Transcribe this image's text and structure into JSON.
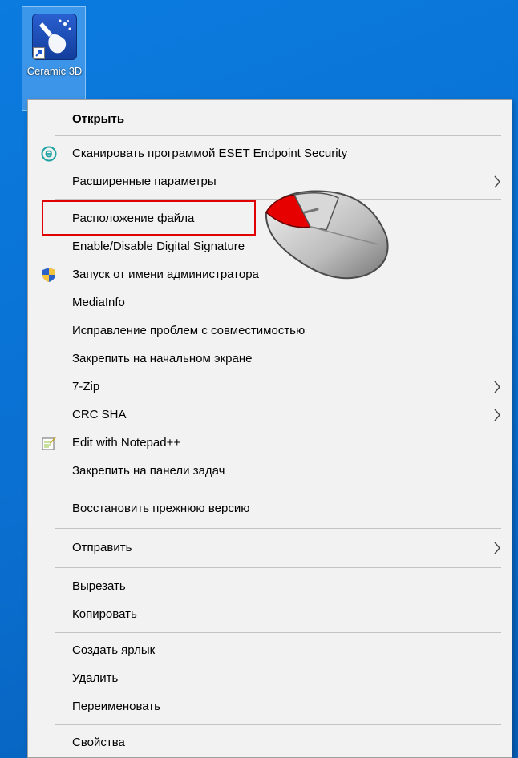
{
  "desktop": {
    "icon_label": "Ceramic 3D",
    "icon_name": "ceramic-3d-icon"
  },
  "menu": {
    "items": [
      {
        "id": "open",
        "label": "Открыть",
        "bold": true
      },
      {
        "id": "eset-scan",
        "label": "Сканировать программой ESET Endpoint Security",
        "icon": "eset-icon"
      },
      {
        "id": "advanced",
        "label": "Расширенные параметры",
        "submenu": true
      },
      {
        "id": "file-location",
        "label": "Расположение файла",
        "highlighted": true
      },
      {
        "id": "digital-signature",
        "label": "Enable/Disable Digital Signature"
      },
      {
        "id": "run-as-admin",
        "label": "Запуск от имени администратора",
        "icon": "uac-shield-icon"
      },
      {
        "id": "mediainfo",
        "label": "MediaInfo"
      },
      {
        "id": "compat",
        "label": "Исправление проблем с совместимостью"
      },
      {
        "id": "pin-start",
        "label": "Закрепить на начальном экране"
      },
      {
        "id": "7zip",
        "label": "7-Zip",
        "submenu": true
      },
      {
        "id": "crc-sha",
        "label": "CRC SHA",
        "submenu": true
      },
      {
        "id": "notepadpp",
        "label": "Edit with Notepad++",
        "icon": "notepadpp-icon"
      },
      {
        "id": "pin-taskbar",
        "label": "Закрепить на панели задач"
      },
      {
        "id": "restore",
        "label": "Восстановить прежнюю версию"
      },
      {
        "id": "send-to",
        "label": "Отправить",
        "submenu": true
      },
      {
        "id": "cut",
        "label": "Вырезать"
      },
      {
        "id": "copy",
        "label": "Копировать"
      },
      {
        "id": "create-shortcut",
        "label": "Создать ярлык"
      },
      {
        "id": "delete",
        "label": "Удалить"
      },
      {
        "id": "rename",
        "label": "Переименовать"
      },
      {
        "id": "properties",
        "label": "Свойства"
      }
    ]
  },
  "colors": {
    "desktop": "#0a74d6",
    "menu_bg": "#f2f2f2",
    "highlight_border": "#e10000",
    "eset_teal": "#1fa3a3"
  }
}
